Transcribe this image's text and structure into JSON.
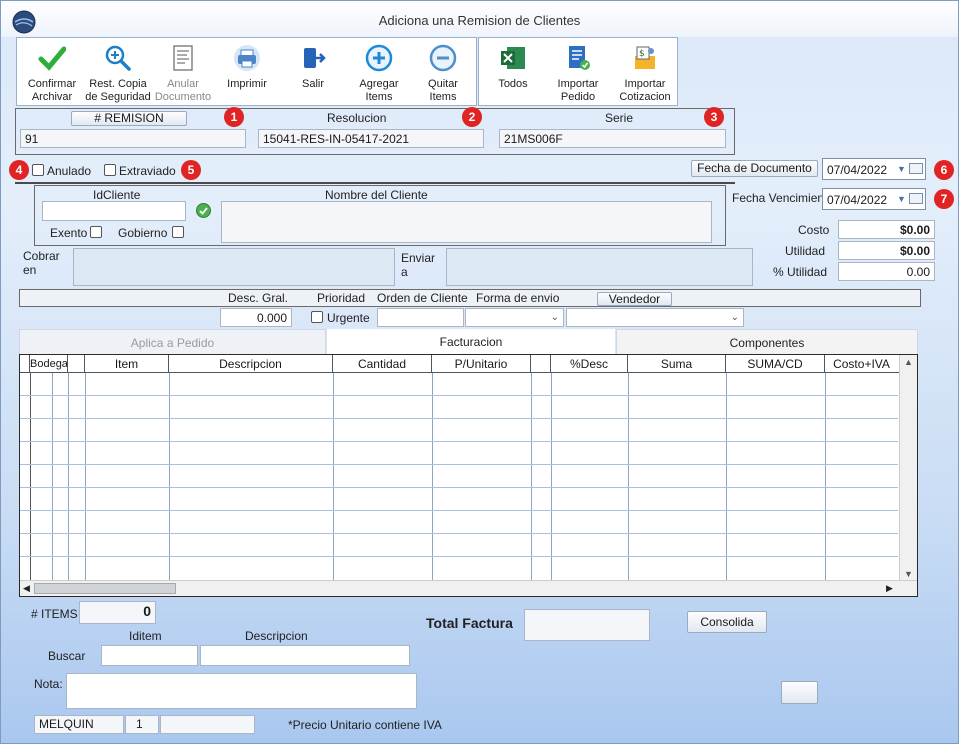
{
  "window": {
    "title": "Adiciona una Remision de Clientes"
  },
  "toolbar": {
    "confirmar": "Confirmar\nArchivar",
    "rest_copia": "Rest. Copia\nde Seguridad",
    "anular": "Anular\nDocumento",
    "imprimir": "Imprimir",
    "salir": "Salir",
    "agregar": "Agregar\nItems",
    "quitar": "Quitar\nItems",
    "todos": "Todos",
    "importar_pedido": "Importar\nPedido",
    "importar_cotizacion": "Importar\nCotizacion"
  },
  "header": {
    "remision_label": "# REMISION",
    "remision_value": "91",
    "resolucion_label": "Resolucion",
    "resolucion_value": "15041-RES-IN-05417-2021",
    "serie_label": "Serie",
    "serie_value": "21MS006F"
  },
  "badges": [
    "1",
    "2",
    "3",
    "4",
    "5",
    "6",
    "7"
  ],
  "flags": {
    "anulado": "Anulado",
    "extraviado": "Extraviado"
  },
  "fechas": {
    "documento_label": "Fecha de  Documento",
    "documento_value": "07/04/2022",
    "vencimiento_label": "Fecha Vencimien",
    "vencimiento_value": "07/04/2022"
  },
  "cliente": {
    "id_label": "IdCliente",
    "nombre_label": "Nombre del Cliente",
    "exento": "Exento",
    "gobierno": "Gobierno",
    "cobrar_label": "Cobrar\nen",
    "enviar_label": "Enviar\na"
  },
  "totales": {
    "costo_label": "Costo",
    "costo_value": "$0.00",
    "utilidad_label": "Utilidad",
    "utilidad_value": "$0.00",
    "pct_utilidad_label": "% Utilidad",
    "pct_utilidad_value": "0.00"
  },
  "opciones": {
    "desc_gral_label": "Desc. Gral.",
    "desc_gral_value": "0.000",
    "prioridad_label": "Prioridad",
    "urgente": "Urgente",
    "orden_label": "Orden de Cliente",
    "forma_envio_label": "Forma de envio",
    "vendedor_button": "Vendedor"
  },
  "tabs": [
    {
      "label": "Aplica a Pedido",
      "state": "disabled"
    },
    {
      "label": "Facturacion",
      "state": "active"
    },
    {
      "label": "Componentes",
      "state": "normal"
    }
  ],
  "grid": {
    "columns": [
      "Bodega",
      "Item",
      "Descripcion",
      "Cantidad",
      "P/Unitario",
      "%Desc",
      "Suma",
      "SUMA/CD",
      "Costo+IVA"
    ]
  },
  "footer": {
    "items_label": "# ITEMS",
    "items_value": "0",
    "iditem_label": "Iditem",
    "descripcion_label": "Descripcion",
    "buscar_label": "Buscar",
    "nota_label": "Nota:",
    "total_factura_label": "Total Factura",
    "consolida_button": "Consolida",
    "status_user": "MELQUIN",
    "status_num": "1",
    "precio_note": "*Precio Unitario contiene IVA"
  }
}
